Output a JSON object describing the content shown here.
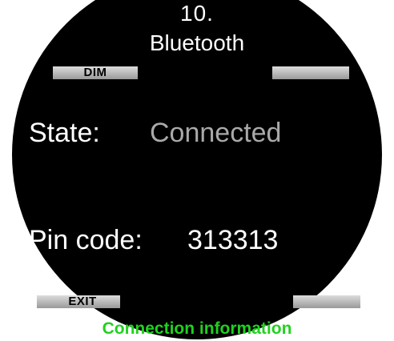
{
  "header": {
    "menu_number": "10.",
    "title": "Bluetooth"
  },
  "softkeys": {
    "top_left": "DIM",
    "top_right": "",
    "bottom_left": "EXIT",
    "bottom_right": ""
  },
  "status": {
    "state_label": "State:",
    "state_value": "Connected",
    "pin_label": "Pin code:",
    "pin_value": "313313"
  },
  "footer": {
    "description": "Connection information"
  },
  "colors": {
    "background": "#000000",
    "primary_text": "#ffffff",
    "secondary_text": "#a9a9a9",
    "footer_text": "#1fd21f",
    "softkey_bar": "#c4c4c4"
  }
}
